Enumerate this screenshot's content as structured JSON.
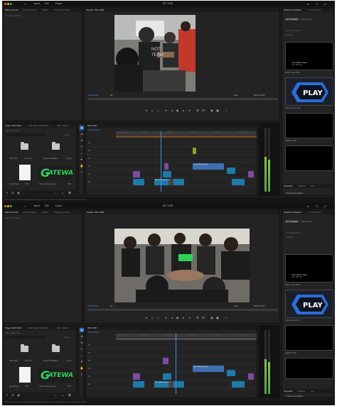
{
  "app": {
    "window_title": "NET 2026",
    "nav": [
      "Import",
      "Edit",
      "Export"
    ]
  },
  "effect_controls": {
    "tabs": [
      "Effect Controls",
      "Lumetri Scopes",
      "Effects",
      "Source: (no clips)"
    ],
    "status": "(no clip selected)"
  },
  "program": {
    "tab": "Program: NPC 2026",
    "timecode_top": "00:00:04:03",
    "timecode_bottom": "00:00:06:07",
    "fit": "Fit",
    "quality": "Full",
    "duration_top": "00:01:14:07",
    "duration_bottom": "00:01:14:07"
  },
  "graphics": {
    "tabs": [
      "Graphics Templates",
      "Lumetri Color",
      "Libraries"
    ],
    "subtabs": [
      "My Templates",
      "Adobe Stock"
    ],
    "sections": [
      "Local Templates",
      "Libraries"
    ],
    "items": [
      {
        "label": "Basic Lower Third",
        "thumb_title": "Your Name Here",
        "thumb_sub": "Your Title Here"
      },
      {
        "label": "Gaming Logo Intro",
        "thumb_title": "PLAY",
        "thumb_sub": ""
      },
      {
        "label": "Digital Credits",
        "thumb_title": "",
        "thumb_sub": ""
      }
    ],
    "bottom_tabs": [
      "Properties",
      "Markers",
      "Info"
    ],
    "create_button": "Create new graphic"
  },
  "project": {
    "tabs": [
      "Project: NET 2026",
      "Bin: Name Pendidikan",
      "Bin: Imports"
    ],
    "path": "NET 2026.prproj",
    "count": "5 items",
    "items": [
      {
        "type": "folder",
        "label": "NET 2026",
        "meta": "25 items"
      },
      {
        "type": "folder",
        "label": "Name Pendidikan",
        "meta": "7 items"
      },
      {
        "type": "white",
        "label": "bg putih.jpg",
        "meta": "5:00"
      },
      {
        "type": "gateway",
        "label": "Green Gateway.png",
        "meta": "5:00",
        "logo_prefix": "G",
        "logo_text": "ATEWAY"
      }
    ]
  },
  "timeline": {
    "tab": "NPC 2026",
    "timecode_top": "00:00:04:03",
    "timecode_bottom": "00:00:06:07",
    "ruler_ticks": [
      "00:00:00:00",
      "00:00:15:00",
      "00:00:30:00",
      "00:00:45:00",
      "00:01:00:00",
      "00:01:15:00"
    ],
    "tracks": [
      "V4",
      "V3",
      "V2",
      "V1",
      "A1",
      "A2"
    ],
    "clip_labels": {
      "title": "Green Marketing_Vo...",
      "audio": "NPC_Backsound_01...",
      "num": "2"
    }
  },
  "audio_meter": {
    "scale": [
      "0",
      "-6",
      "-12",
      "-18",
      "-24",
      "-30",
      "-36",
      "-42",
      "-48",
      "-54"
    ],
    "level_left": 0.55,
    "level_right": 0.5
  },
  "status_bar": "Click to select, or click in empty space and drag to marquee select. Use Shift, Opt, and Cmd for other options.",
  "colors": {
    "accent": "#3d8fe0",
    "clip_video": "#7e4aa5",
    "clip_audio": "#1e7aa8",
    "clip_title": "#3f6fb1",
    "gateway": "#2fd35a"
  }
}
